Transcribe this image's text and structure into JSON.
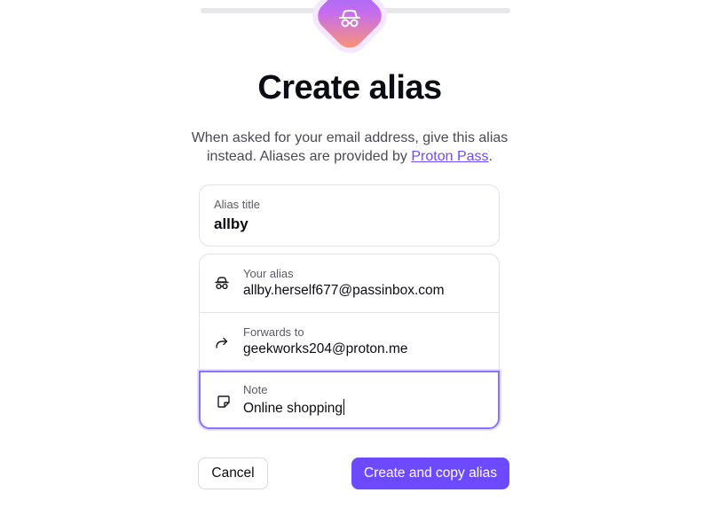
{
  "header": {
    "title": "Create alias",
    "description_before": "When asked for your email address, give this alias instead. Aliases are provided by",
    "description_link": "Proton Pass",
    "description_after": "."
  },
  "alias_title_field": {
    "label": "Alias title",
    "value": "allby"
  },
  "fields": {
    "your_alias": {
      "label": "Your alias",
      "value": "allby.herself677@passinbox.com",
      "icon": "incognito-icon"
    },
    "forwards_to": {
      "label": "Forwards to",
      "value": "geekworks204@proton.me",
      "icon": "forward-arrow-icon"
    },
    "note": {
      "label": "Note",
      "value": "Online shopping",
      "icon": "note-icon"
    }
  },
  "buttons": {
    "cancel_label": "Cancel",
    "create_label": "Create and copy alias"
  },
  "colors": {
    "accent": "#6d4aff",
    "focus_border": "#8a72ff"
  }
}
